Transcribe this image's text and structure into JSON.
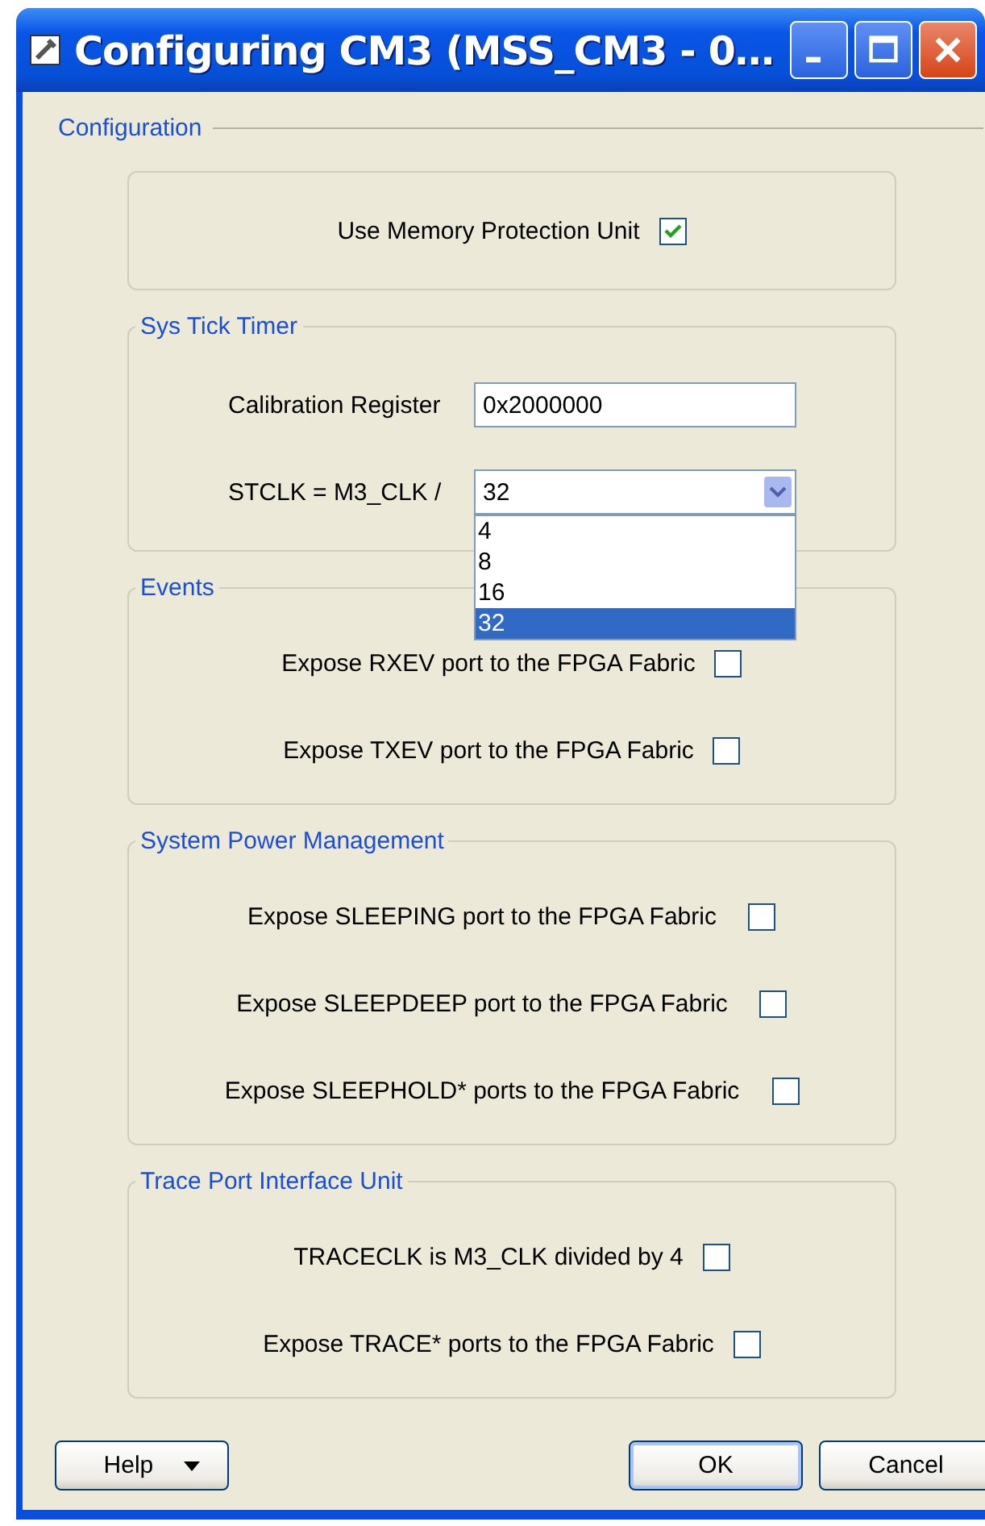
{
  "window": {
    "title": "Configuring CM3 (MSS_CM3 - 0…"
  },
  "configuration": {
    "legend": "Configuration",
    "groups": [
      {
        "rows": [
          {
            "kind": "checkbox",
            "label": "Use Memory Protection Unit",
            "checked": true
          }
        ]
      },
      {
        "legend": "Sys Tick Timer",
        "rows": [
          {
            "kind": "text",
            "label": "Calibration Register",
            "value": "0x2000000"
          },
          {
            "kind": "select",
            "label": "STCLK = M3_CLK /",
            "value": "32",
            "expanded": true,
            "options": [
              {
                "label": "4",
                "selected": false
              },
              {
                "label": "8",
                "selected": false
              },
              {
                "label": "16",
                "selected": false
              },
              {
                "label": "32",
                "selected": true
              }
            ]
          }
        ]
      },
      {
        "legend": "Events",
        "rows": [
          {
            "kind": "checkbox",
            "label": "Expose RXEV port to the FPGA Fabric",
            "checked": false
          },
          {
            "kind": "checkbox",
            "label": "Expose TXEV port to the FPGA Fabric",
            "checked": false
          }
        ]
      },
      {
        "legend": "System Power Management",
        "rows": [
          {
            "kind": "checkbox",
            "label": "Expose SLEEPING port to the FPGA Fabric",
            "checked": false
          },
          {
            "kind": "checkbox",
            "label": "Expose SLEEPDEEP port to the FPGA Fabric",
            "checked": false
          },
          {
            "kind": "checkbox",
            "label": "Expose SLEEPHOLD* ports to the FPGA Fabric",
            "checked": false
          }
        ]
      },
      {
        "legend": "Trace Port Interface Unit",
        "rows": [
          {
            "kind": "checkbox",
            "label": "TRACECLK is M3_CLK divided by 4",
            "checked": false
          },
          {
            "kind": "checkbox",
            "label": "Expose TRACE* ports to the FPGA Fabric",
            "checked": false
          }
        ]
      }
    ]
  },
  "buttons": {
    "help": "Help",
    "ok": "OK",
    "cancel": "Cancel"
  }
}
